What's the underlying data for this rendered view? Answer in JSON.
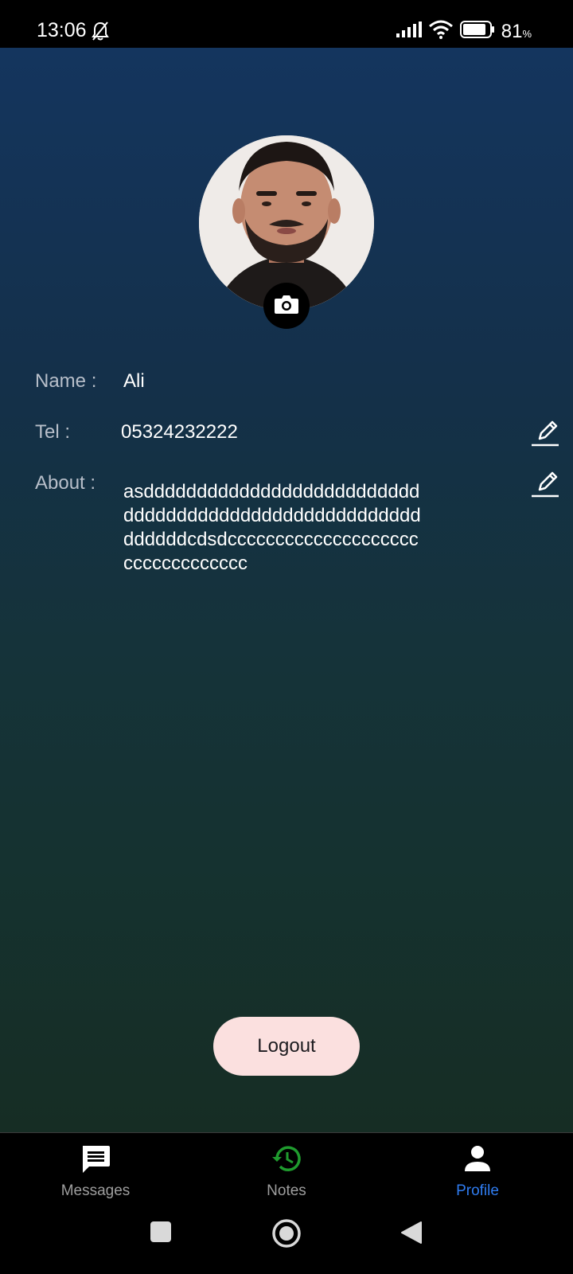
{
  "status_bar": {
    "time": "13:06",
    "battery": "81",
    "battery_unit": "%",
    "icons": [
      "bell-off-icon",
      "signal-icon",
      "wifi-icon",
      "battery-icon"
    ]
  },
  "profile": {
    "name_label": "Name :",
    "name_value": "Ali",
    "tel_label": "Tel :",
    "tel_value": "05324232222",
    "about_label": "About :",
    "about_value": "asddddddddddddddddddddddddddddddddddddddddddddddddddddddddddddcdsdccccccccccccccccccccccccccccccccc"
  },
  "logout_label": "Logout",
  "bottom_nav": {
    "items": [
      {
        "label": "Messages",
        "icon": "message-icon",
        "active": false
      },
      {
        "label": "Notes",
        "icon": "history-icon",
        "active": false
      },
      {
        "label": "Profile",
        "icon": "person-icon",
        "active": true
      }
    ]
  },
  "colors": {
    "accent": "#2f7cf0",
    "notes_icon": "#1f9b2e",
    "logout_bg": "#fbe0df"
  }
}
